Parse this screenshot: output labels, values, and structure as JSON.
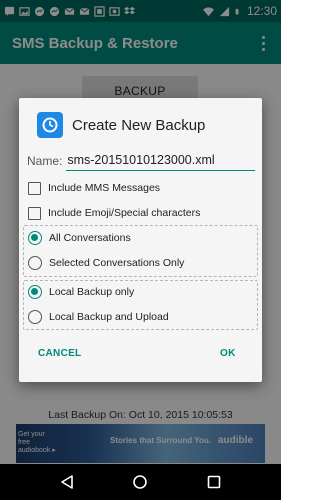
{
  "status_bar": {
    "time": "12:30"
  },
  "app_bar": {
    "title": "SMS Backup & Restore"
  },
  "main": {
    "backup_button_label": "BACKUP",
    "last_backup": "Last Backup On: Oct 10, 2015 10:05:53"
  },
  "ad": {
    "left_text": "Get your free audiobook ▸",
    "middle_text": "Stories that Surround You.",
    "brand": "audible"
  },
  "dialog": {
    "title": "Create New Backup",
    "name_label": "Name:",
    "name_value": "sms-20151010123000.xml",
    "options": {
      "include_mms": {
        "label": "Include MMS Messages",
        "checked": false
      },
      "include_emoji": {
        "label": "Include Emoji/Special characters",
        "checked": false
      }
    },
    "conversations": {
      "all": {
        "label": "All Conversations",
        "selected": true
      },
      "selected_only": {
        "label": "Selected Conversations Only",
        "selected": false
      }
    },
    "backup_location": {
      "local_only": {
        "label": "Local Backup only",
        "selected": true
      },
      "local_upload": {
        "label": "Local Backup and Upload",
        "selected": false
      }
    },
    "cancel_label": "CANCEL",
    "ok_label": "OK"
  },
  "colors": {
    "primary": "#00897b",
    "primary_dark": "#00665e",
    "app_icon": "#1e88e5"
  },
  "icons": {
    "status_left": [
      "sms-icon",
      "photo-icon",
      "messenger-icon",
      "messenger-icon",
      "mail-icon",
      "mail-icon",
      "gallery-icon",
      "photo-icon",
      "dropbox-icon"
    ],
    "status_right": [
      "wifi-icon",
      "signal-icon",
      "battery-icon"
    ],
    "nav": [
      "back-icon",
      "home-icon",
      "recents-icon"
    ]
  }
}
